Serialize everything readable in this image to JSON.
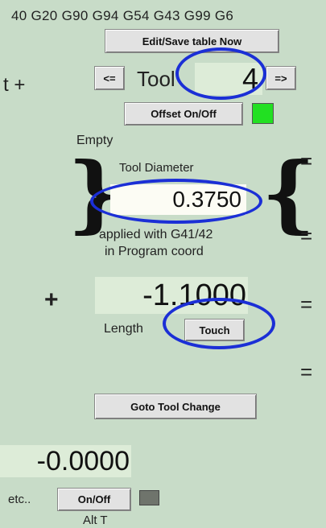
{
  "header": {
    "gcode_modes": "40 G20 G90 G94 G54 G43 G99 G6"
  },
  "buttons": {
    "edit_save_table": "Edit/Save table Now",
    "prev_tool": "<=",
    "next_tool": "=>",
    "offset_on_off": "Offset On/Off",
    "touch": "Touch",
    "goto_tool_change": "Goto Tool Change",
    "alt_on_off": "On/Off"
  },
  "tool": {
    "label": "Tool",
    "number": "4",
    "description": "Empty",
    "diameter_label": "Tool Diameter",
    "diameter": "0.3750",
    "applied_note_1": "applied with G41/42",
    "applied_note_2": "in Program coord",
    "length_value": "-1.1000",
    "length_label": "Length",
    "plus": "+"
  },
  "left": {
    "partial_label": "t +",
    "partial_value": "-0.0000",
    "etc": "etc..",
    "alt_t": "Alt T"
  },
  "equals": "=",
  "colors": {
    "offset_led": "#22e022",
    "alt_led": "#6f746c",
    "highlight_circle": "#1b2fd6",
    "background": "#c8dcc8"
  }
}
